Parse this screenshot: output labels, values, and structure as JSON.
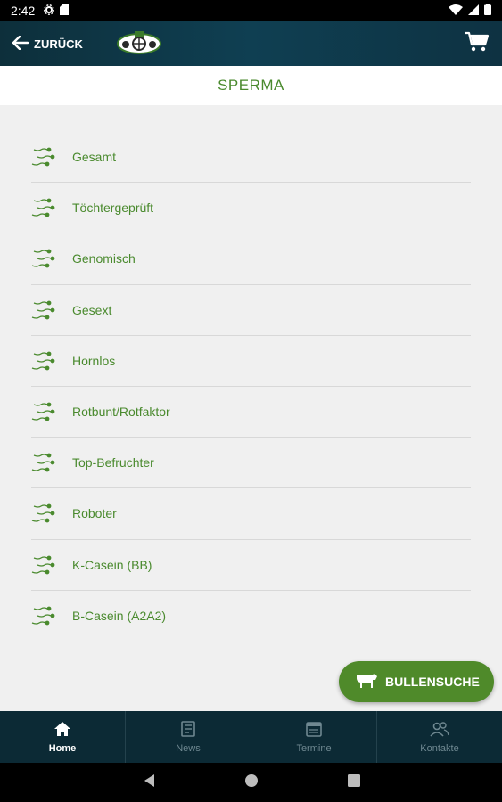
{
  "status": {
    "time": "2:42"
  },
  "appbar": {
    "back_label": "ZURÜCK"
  },
  "page": {
    "title": "SPERMA"
  },
  "menu": {
    "items": [
      {
        "label": "Gesamt"
      },
      {
        "label": "Töchtergeprüft"
      },
      {
        "label": "Genomisch"
      },
      {
        "label": "Gesext"
      },
      {
        "label": "Hornlos"
      },
      {
        "label": "Rotbunt/Rotfaktor"
      },
      {
        "label": "Top-Befruchter"
      },
      {
        "label": "Roboter"
      },
      {
        "label": "K-Casein (BB)"
      },
      {
        "label": "B-Casein (A2A2)"
      }
    ]
  },
  "fab": {
    "label": "BULLENSUCHE"
  },
  "nav": {
    "tabs": [
      {
        "label": "Home",
        "icon": "home-icon"
      },
      {
        "label": "News",
        "icon": "news-icon"
      },
      {
        "label": "Termine",
        "icon": "calendar-icon"
      },
      {
        "label": "Kontakte",
        "icon": "contacts-icon"
      }
    ]
  },
  "colors": {
    "accent_green": "#4a8a2e",
    "header_navy": "#0f3f52",
    "nav_bg": "#0c2a35"
  }
}
